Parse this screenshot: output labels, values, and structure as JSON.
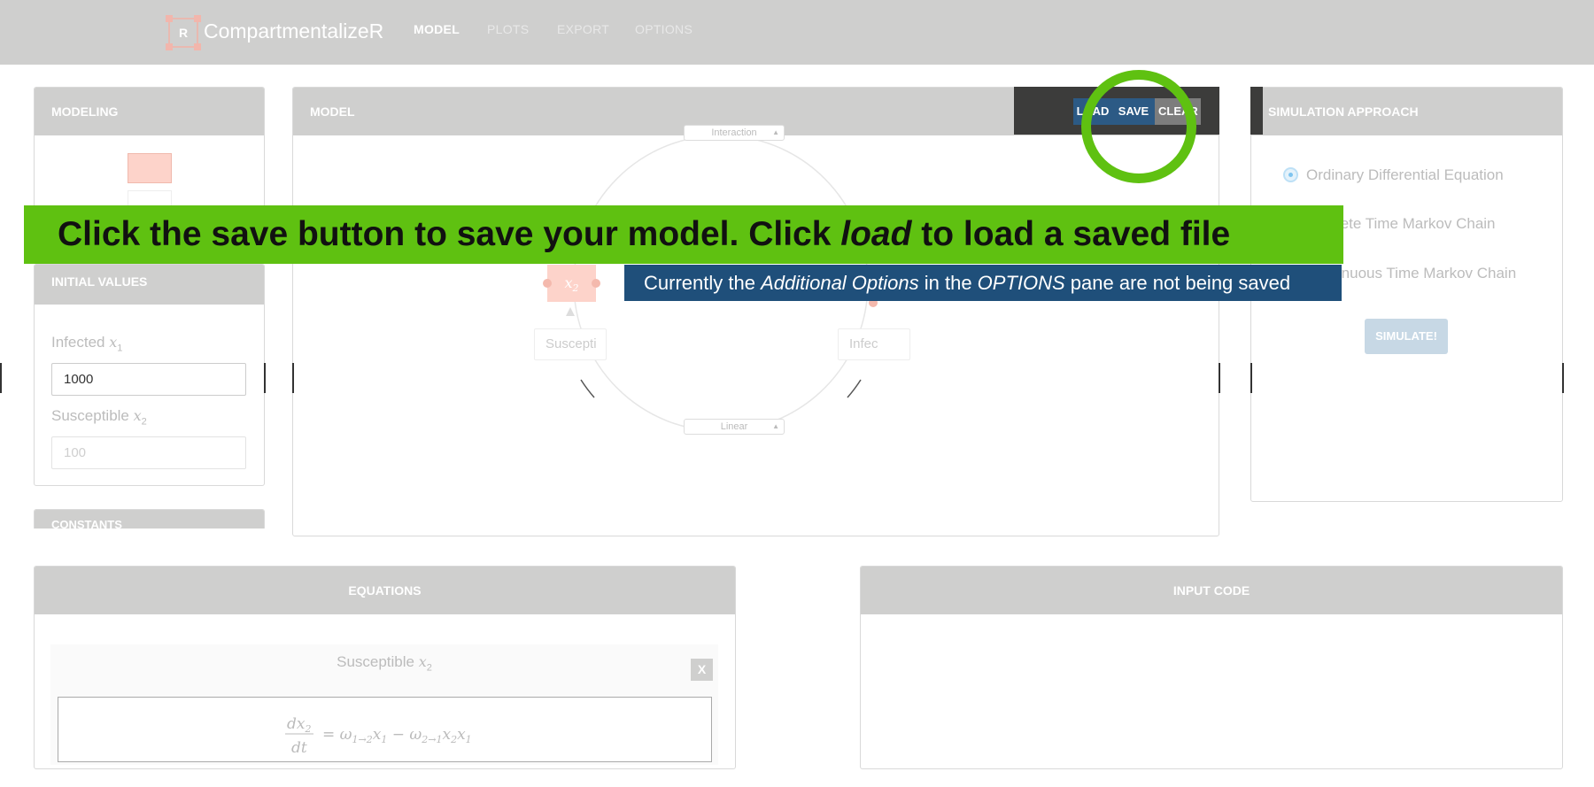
{
  "app": {
    "name": "CompartmentalizeR",
    "logo_letter": "R"
  },
  "nav": {
    "items": [
      "MODEL",
      "PLOTS",
      "EXPORT",
      "OPTIONS"
    ],
    "active": "MODEL"
  },
  "modeling_panel": {
    "title": "MODELING",
    "initial_values_title": "INITIAL VALUES",
    "constants_title": "CONSTANTS",
    "fields": [
      {
        "label": "Infected",
        "var": "x",
        "sub": "1",
        "value": "1000"
      },
      {
        "label": "Susceptible",
        "var": "x",
        "sub": "2",
        "placeholder": "100"
      }
    ]
  },
  "model_panel": {
    "title": "MODEL",
    "buttons": {
      "load": "LOAD",
      "save": "SAVE",
      "clear": "CLEAR"
    },
    "top_select": "Interaction",
    "bottom_select": "Linear",
    "node": {
      "var": "x",
      "sub": "2"
    },
    "labels": {
      "left": "Suscepti",
      "right": "Infec"
    }
  },
  "simulation_panel": {
    "title": "SIMULATION APPROACH",
    "options": [
      {
        "label": "Ordinary Differential Equation",
        "selected": true
      },
      {
        "label": "Discrete Time Markov Chain",
        "selected": false
      },
      {
        "label": "Continuous Time Markov Chain",
        "selected": false
      }
    ],
    "simulate_label": "SIMULATE!"
  },
  "equations_panel": {
    "title": "EQUATIONS",
    "card_title": "Susceptible",
    "card_var": "x",
    "card_sub": "2",
    "close_label": "X",
    "equation": "dx2/dt = ω1→2 x1 − ω2→1 x2 x1"
  },
  "input_code_panel": {
    "title": "INPUT CODE"
  },
  "overlay": {
    "main": {
      "before": "Click the save button to save your model. Click ",
      "italic": "load",
      "after": " to load a saved file"
    },
    "sub": {
      "t1": "Currently the ",
      "i1": "Additional Options",
      "t2": " in the ",
      "i2": "OPTIONS",
      "t3": " pane are not being saved"
    }
  },
  "colors": {
    "header_gray": "#cfcfce",
    "highlight_green": "#5fc111",
    "banner_blue": "#1f4f7a",
    "button_blue": "#2c5a85",
    "node_pink": "#fdd3ca"
  }
}
